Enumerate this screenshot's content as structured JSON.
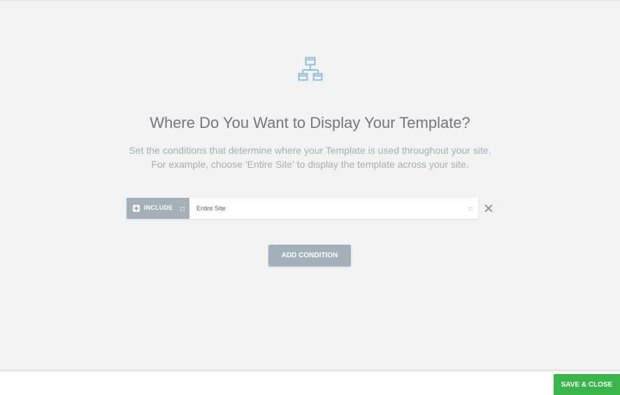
{
  "header": {
    "icon": "sitemap-icon",
    "title": "Where Do You Want to Display Your Template?",
    "description_line1": "Set the conditions that determine where your Template is used throughout your site.",
    "description_line2": "For example, choose 'Entire Site' to display the template across your site."
  },
  "conditions": [
    {
      "type_label": "INCLUDE",
      "target": "Entire Site"
    }
  ],
  "actions": {
    "add_condition_label": "ADD CONDITION",
    "save_close_label": "SAVE & CLOSE"
  },
  "colors": {
    "accent": "#39b54a",
    "muted": "#a4afb7",
    "background": "#f1f2f3",
    "icon": "#93c0d5"
  }
}
